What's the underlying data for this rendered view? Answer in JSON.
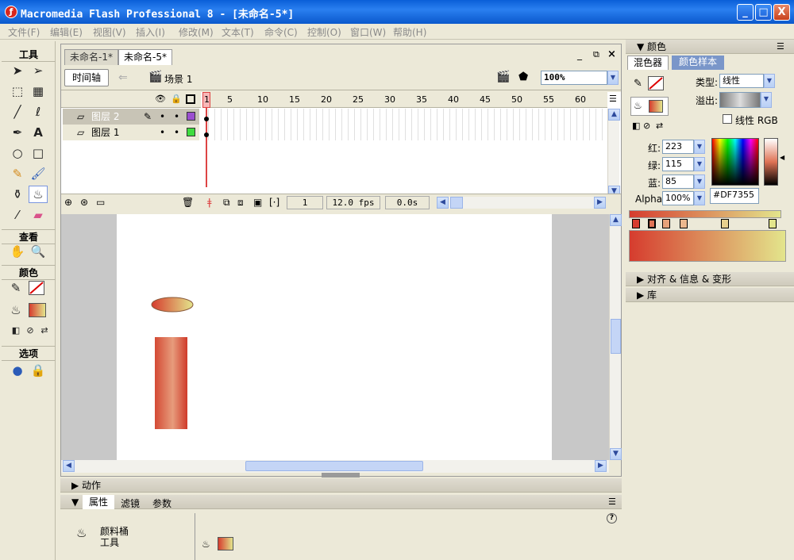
{
  "window": {
    "title": "Macromedia Flash Professional 8 - [未命名-5*]",
    "min": "_",
    "max": "□",
    "close": "X"
  },
  "menu": [
    "文件(F)",
    "编辑(E)",
    "视图(V)",
    "插入(I)",
    "修改(M)",
    "文本(T)",
    "命令(C)",
    "控制(O)",
    "窗口(W)",
    "帮助(H)"
  ],
  "tools": {
    "header": "工具",
    "view_header": "查看",
    "color_header": "颜色",
    "options_header": "选项"
  },
  "document": {
    "tabs": [
      "未命名-1*",
      "未命名-5*"
    ],
    "timeline_button": "时间轴",
    "scene_label": "场景 1",
    "zoom": "100%",
    "frame_numbers": [
      "1",
      "5",
      "10",
      "15",
      "20",
      "25",
      "30",
      "35",
      "40",
      "45",
      "50",
      "55",
      "60"
    ],
    "layers": [
      {
        "name": "图层 2",
        "color": "#9b4fd0"
      },
      {
        "name": "图层 1",
        "color": "#3fdc3f"
      }
    ],
    "current_frame": "1",
    "fps": "12.0 fps",
    "time": "0.0s"
  },
  "right_panel": {
    "color_title": "颜色",
    "tabs": [
      "混色器",
      "颜色样本"
    ],
    "type_label": "类型:",
    "type_value": "线性",
    "overflow_label": "溢出:",
    "linear_rgb": "线性 RGB",
    "red_label": "红:",
    "red": "223",
    "green_label": "绿:",
    "green": "115",
    "blue_label": "蓝:",
    "blue": "85",
    "alpha_label": "Alpha:",
    "alpha": "100%",
    "hex": "#DF7355",
    "align_panel": "对齐 & 信息 & 变形",
    "library_panel": "库"
  },
  "bottom_panel": {
    "actions": "动作",
    "tabs": [
      "属性",
      "滤镜",
      "参数"
    ],
    "tool_name_line1": "颜料桶",
    "tool_name_line2": "工具",
    "help": "?"
  },
  "colors": {
    "gradient_start": "#d63c2e",
    "gradient_end": "#e3e58c",
    "accent": "#DF7355"
  }
}
